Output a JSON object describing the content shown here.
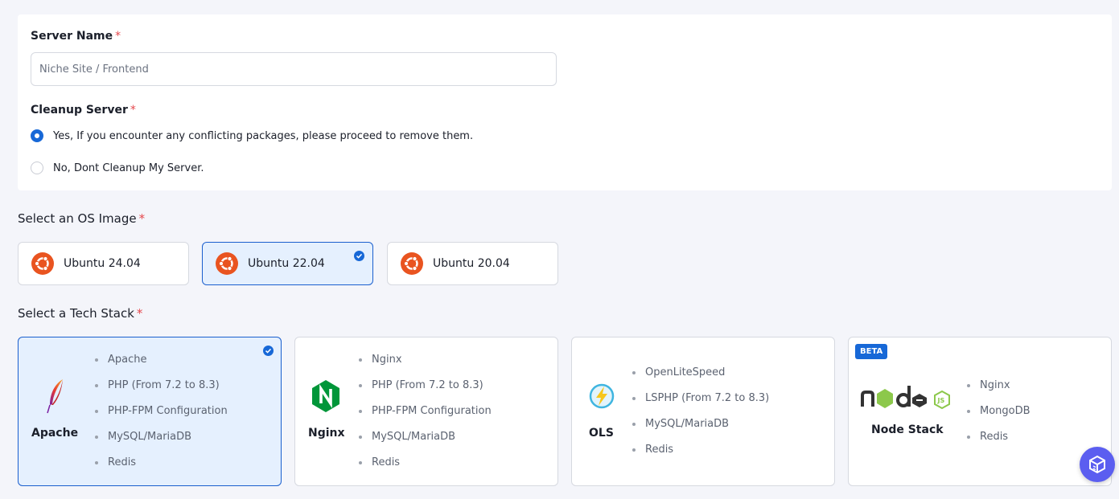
{
  "server_name": {
    "label": "Server Name",
    "required_mark": "*",
    "placeholder": "Niche Site / Frontend",
    "value": ""
  },
  "cleanup": {
    "label": "Cleanup Server",
    "required_mark": "*",
    "options": [
      {
        "label": "Yes, If you encounter any conflicting packages, please proceed to remove them.",
        "selected": true
      },
      {
        "label": "No, Dont Cleanup My Server.",
        "selected": false
      }
    ]
  },
  "os": {
    "title": "Select an OS Image",
    "required_mark": "*",
    "options": [
      {
        "name": "Ubuntu 24.04",
        "selected": false,
        "icon": "ubuntu-icon"
      },
      {
        "name": "Ubuntu 22.04",
        "selected": true,
        "icon": "ubuntu-icon"
      },
      {
        "name": "Ubuntu 20.04",
        "selected": false,
        "icon": "ubuntu-icon"
      }
    ]
  },
  "stack": {
    "title": "Select a Tech Stack",
    "required_mark": "*",
    "options": [
      {
        "name": "Apache",
        "selected": true,
        "icon": "apache-feather-icon",
        "features": [
          "Apache",
          "PHP (From 7.2 to 8.3)",
          "PHP-FPM Configuration",
          "MySQL/MariaDB",
          "Redis"
        ]
      },
      {
        "name": "Nginx",
        "selected": false,
        "icon": "nginx-icon",
        "features": [
          "Nginx",
          "PHP (From 7.2 to 8.3)",
          "PHP-FPM Configuration",
          "MySQL/MariaDB",
          "Redis"
        ]
      },
      {
        "name": "OLS",
        "selected": false,
        "icon": "openlitespeed-icon",
        "features": [
          "OpenLiteSpeed",
          "LSPHP (From 7.2 to 8.3)",
          "MySQL/MariaDB",
          "Redis"
        ]
      },
      {
        "name": "Node Stack",
        "selected": false,
        "icon": "nodejs-icon",
        "badge": "BETA",
        "features": [
          "Nginx",
          "MongoDB",
          "Redis"
        ]
      }
    ]
  },
  "colors": {
    "accent": "#1768d7",
    "selected_bg": "#e5f0fe",
    "required": "#e5484d",
    "ubuntu": "#e95420",
    "nginx": "#009639",
    "node_green": "#8cc84b",
    "fab": "#5b5ef0"
  },
  "fab_icon": "help-box-icon"
}
